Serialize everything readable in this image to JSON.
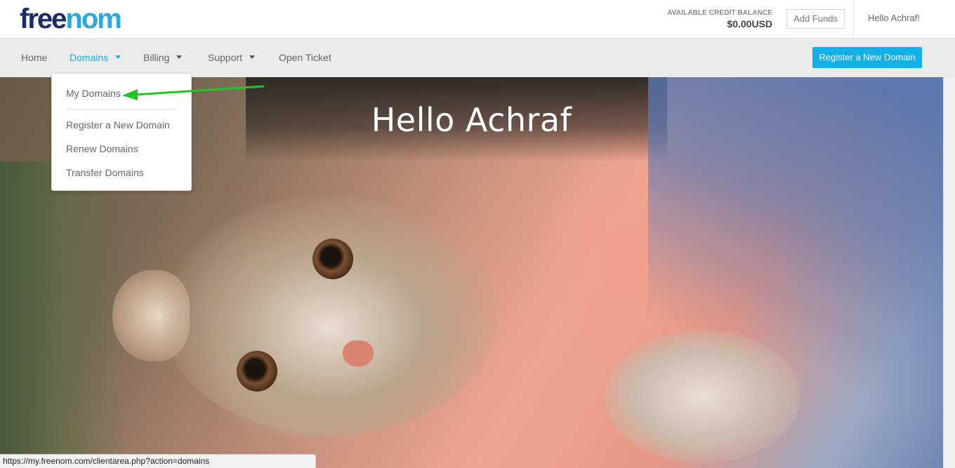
{
  "brand": {
    "logo_part1": "free",
    "logo_part2": "nom",
    "accent_color": "#2aa8e0",
    "dark_color": "#1d2a6b"
  },
  "header": {
    "credit_label": "AVAILABLE CREDIT BALANCE",
    "credit_value": "$0.00USD",
    "add_funds_label": "Add Funds",
    "greeting": "Hello Achraf!"
  },
  "nav": {
    "items": [
      {
        "label": "Home",
        "has_dropdown": false
      },
      {
        "label": "Domains",
        "has_dropdown": true,
        "active": true
      },
      {
        "label": "Billing",
        "has_dropdown": true
      },
      {
        "label": "Support",
        "has_dropdown": true
      },
      {
        "label": "Open Ticket",
        "has_dropdown": false
      }
    ],
    "register_button_label": "Register a New Domain",
    "register_button_color": "#12b0e8"
  },
  "domains_menu": {
    "items": [
      {
        "label": "My Domains"
      },
      {
        "label": "Register a New Domain"
      },
      {
        "label": "Renew Domains"
      },
      {
        "label": "Transfer Domains"
      }
    ]
  },
  "hero": {
    "title": "Hello Achraf"
  },
  "annotation": {
    "arrow_color": "#22c422",
    "target": "My Domains"
  },
  "status_bar": {
    "url": "https://my.freenom.com/clientarea.php?action=domains"
  }
}
